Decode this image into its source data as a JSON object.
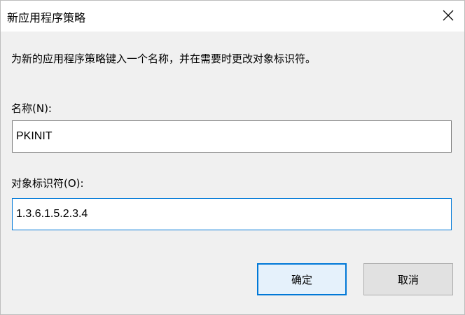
{
  "window": {
    "title": "新应用程序策略"
  },
  "description": "为新的应用程序策略键入一个名称，并在需要时更改对象标识符。",
  "name_field": {
    "label": "名称(N):",
    "value": "PKINIT"
  },
  "oid_field": {
    "label": "对象标识符(O):",
    "value": "1.3.6.1.5.2.3.4"
  },
  "buttons": {
    "ok_label": "确定",
    "cancel_label": "取消"
  },
  "icons": {
    "close": "close-icon"
  },
  "colors": {
    "focus_accent": "#0078d7",
    "dialog_bg": "#f0f0f0",
    "titlebar_bg": "#ffffff"
  }
}
